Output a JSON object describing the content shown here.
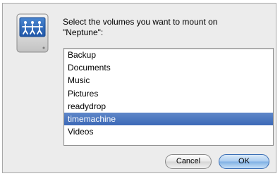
{
  "prompt": {
    "line1": "Select the volumes you want to mount on",
    "line2": "\"Neptune\":"
  },
  "volumes": [
    {
      "label": "Backup",
      "selected": false
    },
    {
      "label": "Documents",
      "selected": false
    },
    {
      "label": "Music",
      "selected": false
    },
    {
      "label": "Pictures",
      "selected": false
    },
    {
      "label": "readydrop",
      "selected": false
    },
    {
      "label": "timemachine",
      "selected": true
    },
    {
      "label": "Videos",
      "selected": false
    }
  ],
  "buttons": {
    "cancel_label": "Cancel",
    "ok_label": "OK"
  },
  "icon": {
    "name": "network-drive-icon"
  },
  "colors": {
    "selection": "#3c69b7",
    "default_button": "#7fb0e4"
  }
}
